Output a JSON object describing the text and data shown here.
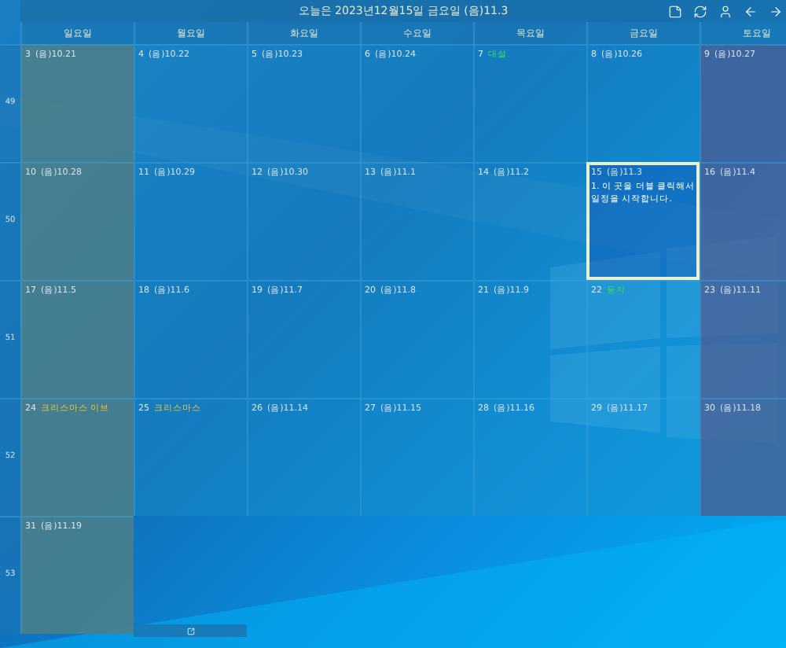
{
  "title": "오늘은 2023년12월15일 금요일 (음)11.3",
  "toolbar": [
    {
      "kind": "note"
    },
    {
      "kind": "refresh"
    },
    {
      "kind": "person"
    },
    {
      "kind": "back"
    },
    {
      "kind": "forward"
    }
  ],
  "day_headers": [
    {
      "label": "일요일",
      "kind": "sunday"
    },
    {
      "label": "월요일",
      "kind": "weekday"
    },
    {
      "label": "화요일",
      "kind": "weekday"
    },
    {
      "label": "수요일",
      "kind": "weekday"
    },
    {
      "label": "목요일",
      "kind": "weekday"
    },
    {
      "label": "금요일",
      "kind": "weekday"
    },
    {
      "label": "토요일",
      "kind": "saturday"
    }
  ],
  "weeks": [
    {
      "number": "49",
      "days": [
        {
          "day": "3",
          "note": "(음)10.21",
          "kind": "lunar",
          "selected": false
        },
        {
          "day": "4",
          "note": "(음)10.22",
          "kind": "lunar",
          "selected": false
        },
        {
          "day": "5",
          "note": "(음)10.23",
          "kind": "lunar",
          "selected": false
        },
        {
          "day": "6",
          "note": "(음)10.24",
          "kind": "lunar",
          "selected": false
        },
        {
          "day": "7",
          "note": "대설",
          "kind": "solar_term",
          "selected": false
        },
        {
          "day": "8",
          "note": "(음)10.26",
          "kind": "lunar",
          "selected": false
        },
        {
          "day": "9",
          "note": "(음)10.27",
          "kind": "lunar",
          "selected": false
        }
      ]
    },
    {
      "number": "50",
      "days": [
        {
          "day": "10",
          "note": "(음)10.28",
          "kind": "lunar",
          "selected": false
        },
        {
          "day": "11",
          "note": "(음)10.29",
          "kind": "lunar",
          "selected": false
        },
        {
          "day": "12",
          "note": "(음)10.30",
          "kind": "lunar",
          "selected": false
        },
        {
          "day": "13",
          "note": "(음)11.1",
          "kind": "lunar",
          "selected": false
        },
        {
          "day": "14",
          "note": "(음)11.2",
          "kind": "lunar",
          "selected": false
        },
        {
          "day": "15",
          "note": "(음)11.3",
          "kind": "lunar",
          "selected": true,
          "events": [
            "1. 이 곳을 더블 클릭해서 일정을 시작합니다."
          ]
        },
        {
          "day": "16",
          "note": "(음)11.4",
          "kind": "lunar",
          "selected": false
        }
      ]
    },
    {
      "number": "51",
      "days": [
        {
          "day": "17",
          "note": "(음)11.5",
          "kind": "lunar",
          "selected": false
        },
        {
          "day": "18",
          "note": "(음)11.6",
          "kind": "lunar",
          "selected": false
        },
        {
          "day": "19",
          "note": "(음)11.7",
          "kind": "lunar",
          "selected": false
        },
        {
          "day": "20",
          "note": "(음)11.8",
          "kind": "lunar",
          "selected": false
        },
        {
          "day": "21",
          "note": "(음)11.9",
          "kind": "lunar",
          "selected": false
        },
        {
          "day": "22",
          "note": "동지",
          "kind": "solar_term",
          "selected": false
        },
        {
          "day": "23",
          "note": "(음)11.11",
          "kind": "lunar",
          "selected": false
        }
      ]
    },
    {
      "number": "52",
      "days": [
        {
          "day": "24",
          "note": "크리스마스 이브",
          "kind": "holiday",
          "selected": false
        },
        {
          "day": "25",
          "note": "크리스마스",
          "kind": "holiday",
          "selected": false
        },
        {
          "day": "26",
          "note": "(음)11.14",
          "kind": "lunar",
          "selected": false
        },
        {
          "day": "27",
          "note": "(음)11.15",
          "kind": "lunar",
          "selected": false
        },
        {
          "day": "28",
          "note": "(음)11.16",
          "kind": "lunar",
          "selected": false
        },
        {
          "day": "29",
          "note": "(음)11.17",
          "kind": "lunar",
          "selected": false
        },
        {
          "day": "30",
          "note": "(음)11.18",
          "kind": "lunar",
          "selected": false
        }
      ]
    },
    {
      "number": "53",
      "days": [
        {
          "day": "31",
          "note": "(음)11.19",
          "kind": "lunar",
          "selected": false
        }
      ]
    }
  ]
}
